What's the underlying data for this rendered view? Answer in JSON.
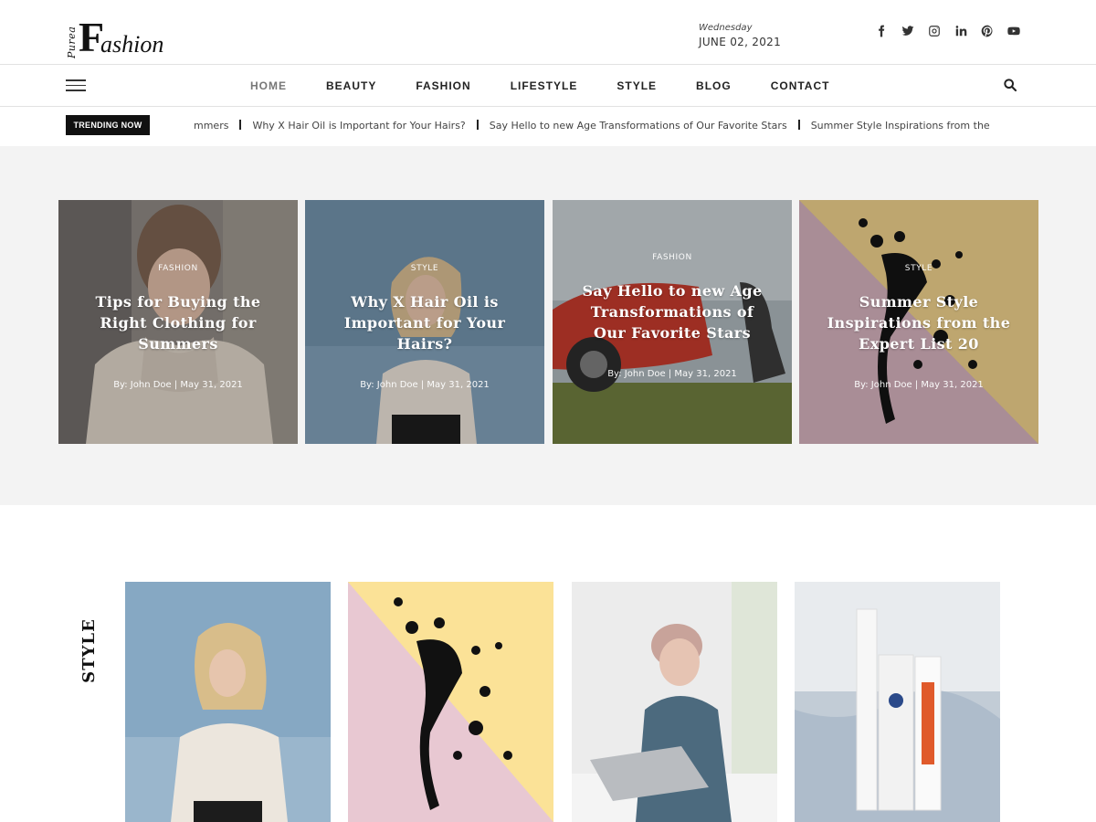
{
  "logo": {
    "small": "Purea",
    "initial": "F",
    "rest": "ashion"
  },
  "date": {
    "weekday": "Wednesday",
    "full": "JUNE 02, 2021"
  },
  "socials": [
    "facebook-icon",
    "twitter-icon",
    "instagram-icon",
    "linkedin-icon",
    "pinterest-icon",
    "youtube-icon"
  ],
  "nav": {
    "items": [
      "HOME",
      "BEAUTY",
      "FASHION",
      "LIFESTYLE",
      "STYLE",
      "BLOG",
      "CONTACT"
    ]
  },
  "trending": {
    "badge": "TRENDING NOW",
    "items": [
      "mmers",
      "Why X Hair Oil is Important for Your Hairs?",
      "Say Hello to new Age Transformations of Our Favorite Stars",
      "Summer Style Inspirations from the"
    ]
  },
  "featured": [
    {
      "category": "FASHION",
      "title": "Tips for Buying the Right Clothing for Summers",
      "meta": "By: John Doe | May 31, 2021"
    },
    {
      "category": "STYLE",
      "title": "Why X Hair Oil is Important for Your Hairs?",
      "meta": "By: John Doe | May 31, 2021"
    },
    {
      "category": "FASHION",
      "title": "Say Hello to new Age Transformations of Our Favorite Stars",
      "meta": "By: John Doe | May 31, 2021"
    },
    {
      "category": "STYLE",
      "title": "Summer Style Inspirations from the Expert List 20",
      "meta": "By: John Doe | May 31, 2021"
    }
  ],
  "section": {
    "label": "STYLE"
  },
  "colors": {
    "accent": "#111111",
    "band": "#f3f3f3"
  }
}
